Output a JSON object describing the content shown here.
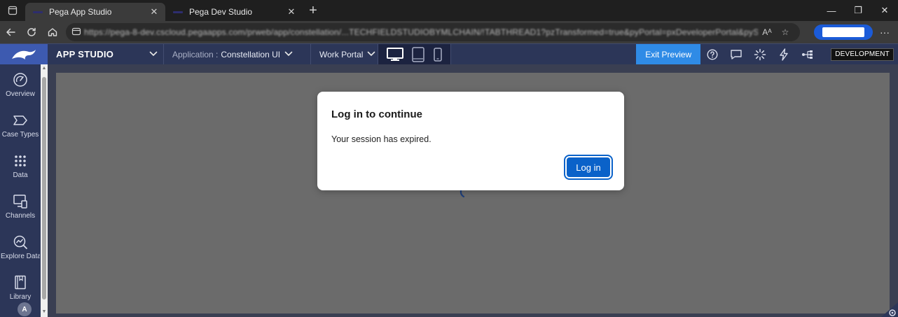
{
  "browser": {
    "tabs": [
      {
        "title": "Pega App Studio",
        "active": true
      },
      {
        "title": "Pega Dev Studio",
        "active": false
      }
    ],
    "close_glyph": "✕",
    "new_tab_glyph": "+",
    "url": "https://pega-8-dev.cscloud.pegaapps.com/prweb/app/constellation/...TECHFIELDSTUDIOBYMLCHAIN/!TABTHREAD1?pzTransformed=true&pyPortal=pxDeveloperPortal&pySelectedItem=...",
    "read_aloud": "Aᴬ",
    "favorite": "☆",
    "more": "···",
    "window_controls": {
      "minimize": "—",
      "maximize": "❐",
      "close": "✕"
    }
  },
  "header": {
    "studio": "APP STUDIO",
    "application_prefix": "Application :",
    "application": "Constellation UI",
    "portal": "Work Portal",
    "exit_preview": "Exit Preview",
    "environment": "DEVELOPMENT"
  },
  "leftnav": {
    "items": [
      {
        "label": "Overview",
        "icon": "gauge-icon"
      },
      {
        "label": "Case Types",
        "icon": "case-type-icon"
      },
      {
        "label": "Data",
        "icon": "data-grid-icon"
      },
      {
        "label": "Channels",
        "icon": "channels-icon"
      },
      {
        "label": "Explore Data",
        "icon": "explore-data-icon"
      },
      {
        "label": "Library",
        "icon": "library-icon"
      }
    ],
    "avatar": "A"
  },
  "modal": {
    "title": "Log in to continue",
    "message": "Your session has expired.",
    "button": "Log in"
  },
  "colors": {
    "pega_header": "#2c3658",
    "logo_box": "#3d5ab0",
    "exit_preview": "#2f8be6",
    "primary_button": "#0a62c9",
    "canvas_overlay": "#6b6b6b"
  }
}
